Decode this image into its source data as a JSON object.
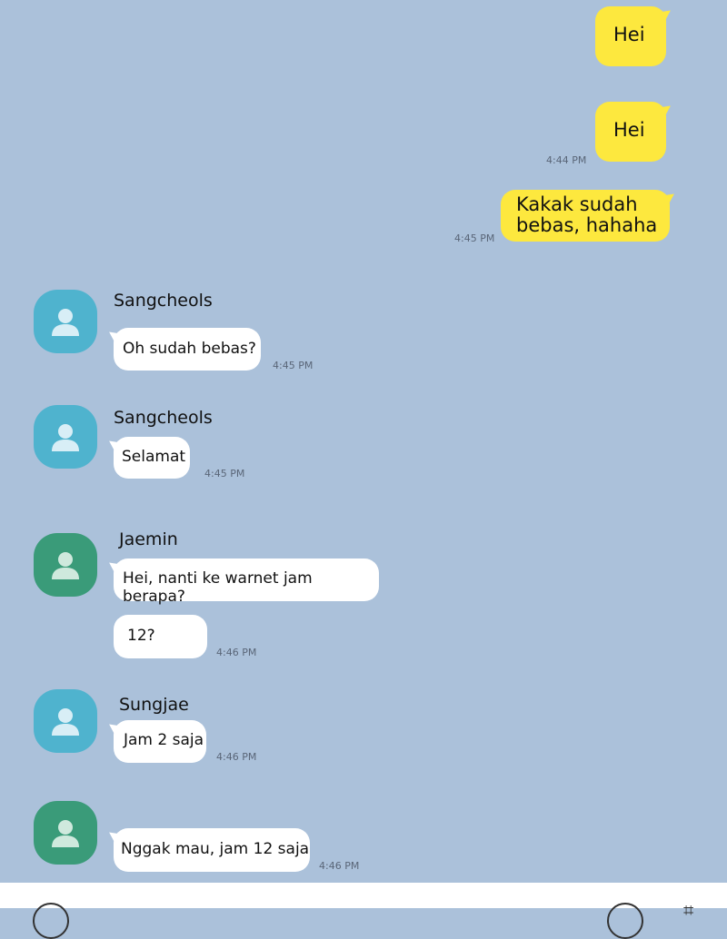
{
  "colors": {
    "background": "#abc1da",
    "my_bubble": "#fde83e",
    "other_bubble": "#ffffff",
    "avatar_blue": "#4fb3ce",
    "avatar_green": "#3a9b79"
  },
  "messages": [
    {
      "from": "me",
      "text": "Hei",
      "time": ""
    },
    {
      "from": "me",
      "text": "Hei",
      "time": "4:44 PM"
    },
    {
      "from": "me",
      "text": "Kakak sudah bebas, hahaha",
      "time": "4:45 PM"
    },
    {
      "from": "Sangcheols",
      "text": "Oh sudah bebas?",
      "time": "4:45 PM"
    },
    {
      "from": "Sangcheols",
      "text": "Selamat",
      "time": "4:45 PM"
    },
    {
      "from": "Jaemin",
      "text": "Hei, nanti ke warnet jam berapa?",
      "time": ""
    },
    {
      "from": "Jaemin",
      "text": "12?",
      "time": "4:46 PM"
    },
    {
      "from": "Sungjae",
      "text": "Jam 2 saja",
      "time": "4:46 PM"
    },
    {
      "from": "",
      "text": "Nggak mau, jam 12 saja",
      "time": "4:46 PM"
    }
  ],
  "icons": {
    "avatar": "person-icon"
  }
}
